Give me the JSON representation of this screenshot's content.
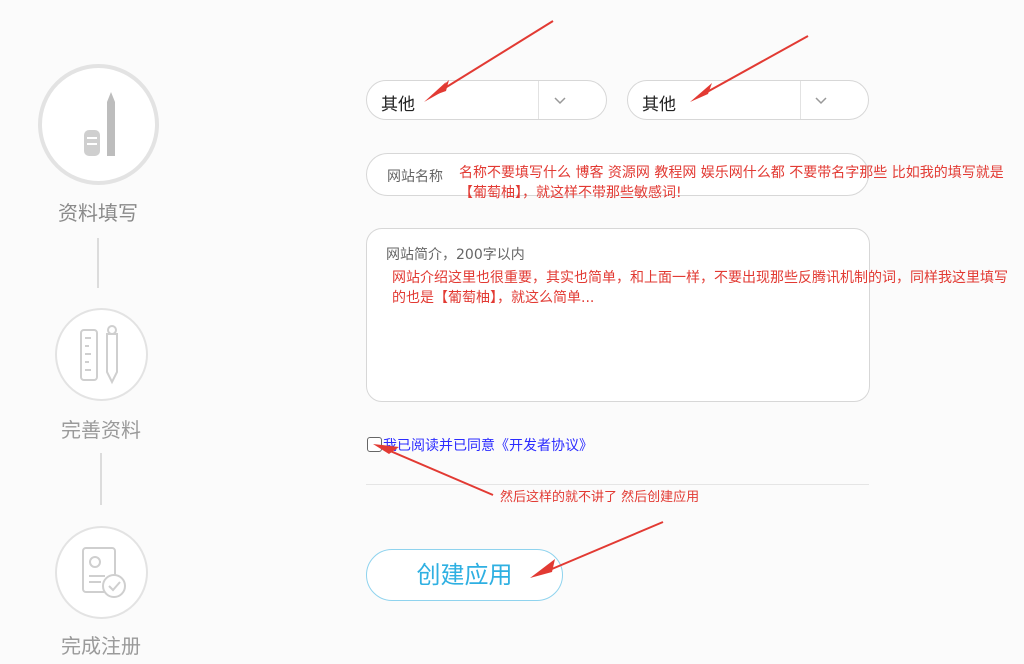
{
  "steps": [
    {
      "label": "资料填写",
      "icon": "pen-icon"
    },
    {
      "label": "完善资料",
      "icon": "ruler-pen-icon"
    },
    {
      "label": "完成注册",
      "icon": "document-check-icon"
    }
  ],
  "form": {
    "select1": {
      "value": "其他"
    },
    "select2": {
      "value": "其他"
    },
    "site_name": {
      "placeholder": "网站名称",
      "note": "名称不要填写什么 博客 资源网 教程网 娱乐网什么都 不要带名字那些  比如我的填写就是【葡萄柚】，就这样不带那些敏感词!"
    },
    "site_desc": {
      "placeholder": "网站简介，200字以内",
      "note": "网站介绍这里也很重要，其实也简单，和上面一样，不要出现那些反腾讯机制的词，同样我这里填写的也是【葡萄柚】，就这么简单..."
    },
    "agreement": {
      "label": "我已阅读并已同意《开发者协议》",
      "checked": false
    },
    "agreement_note": "然后这样的就不讲了 然后创建应用",
    "create_button": "创建应用"
  },
  "colors": {
    "accent": "#2fb0e2",
    "annotation": "#e23a33"
  }
}
